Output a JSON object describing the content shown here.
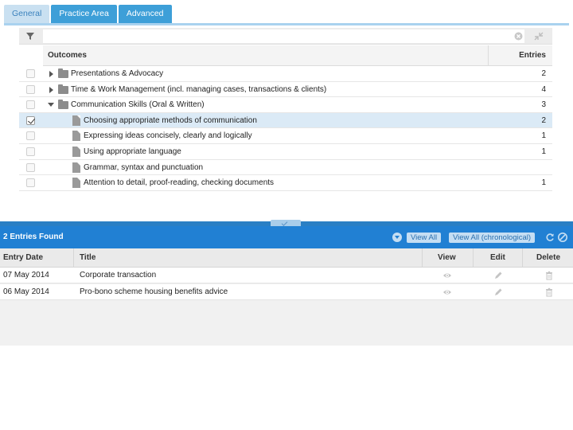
{
  "tabs": [
    {
      "label": "General",
      "active": true
    },
    {
      "label": "Practice Area",
      "active": false
    },
    {
      "label": "Advanced",
      "active": false
    }
  ],
  "filter": {
    "value": "",
    "placeholder": ""
  },
  "tree": {
    "columns": {
      "outcomes": "Outcomes",
      "entries": "Entries"
    },
    "rows": [
      {
        "level": 0,
        "type": "folder",
        "state": "collapsed",
        "checked": false,
        "selected": false,
        "label": "Presentations & Advocacy",
        "count": "2"
      },
      {
        "level": 0,
        "type": "folder",
        "state": "collapsed",
        "checked": false,
        "selected": false,
        "label": "Time & Work Management (incl. managing cases, transactions & clients)",
        "count": "4"
      },
      {
        "level": 0,
        "type": "folder",
        "state": "expanded",
        "checked": false,
        "selected": false,
        "label": "Communication Skills (Oral & Written)",
        "count": "3"
      },
      {
        "level": 1,
        "type": "doc",
        "state": "",
        "checked": true,
        "selected": true,
        "label": "Choosing appropriate methods of communication",
        "count": "2"
      },
      {
        "level": 1,
        "type": "doc",
        "state": "",
        "checked": false,
        "selected": false,
        "label": "Expressing ideas concisely, clearly and logically",
        "count": "1"
      },
      {
        "level": 1,
        "type": "doc",
        "state": "",
        "checked": false,
        "selected": false,
        "label": "Using appropriate language",
        "count": "1"
      },
      {
        "level": 1,
        "type": "doc",
        "state": "",
        "checked": false,
        "selected": false,
        "label": "Grammar, syntax and punctuation",
        "count": ""
      },
      {
        "level": 1,
        "type": "doc",
        "state": "",
        "checked": false,
        "selected": false,
        "label": "Attention to detail, proof-reading, checking documents",
        "count": "1"
      }
    ]
  },
  "results": {
    "title": "2 Entries Found",
    "view_all_label": "View All",
    "view_all_chrono_label": "View All (chronological)",
    "columns": {
      "date": "Entry Date",
      "title": "Title",
      "view": "View",
      "edit": "Edit",
      "delete": "Delete"
    },
    "rows": [
      {
        "date": "07 May 2014",
        "title": "Corporate transaction"
      },
      {
        "date": "06 May 2014",
        "title": "Pro-bono scheme housing benefits advice"
      }
    ]
  },
  "colors": {
    "accent": "#2180d3",
    "tab": "#3d9fd8",
    "tab_active_bg": "#c9e0f1",
    "selected_row": "#dbeaf6"
  },
  "icons": [
    "filter-icon",
    "clear-icon",
    "collapse-all-icon",
    "folder-icon",
    "document-icon",
    "chevron-down-icon",
    "refresh-icon",
    "close-icon",
    "eye-icon",
    "pencil-icon",
    "trash-icon"
  ]
}
